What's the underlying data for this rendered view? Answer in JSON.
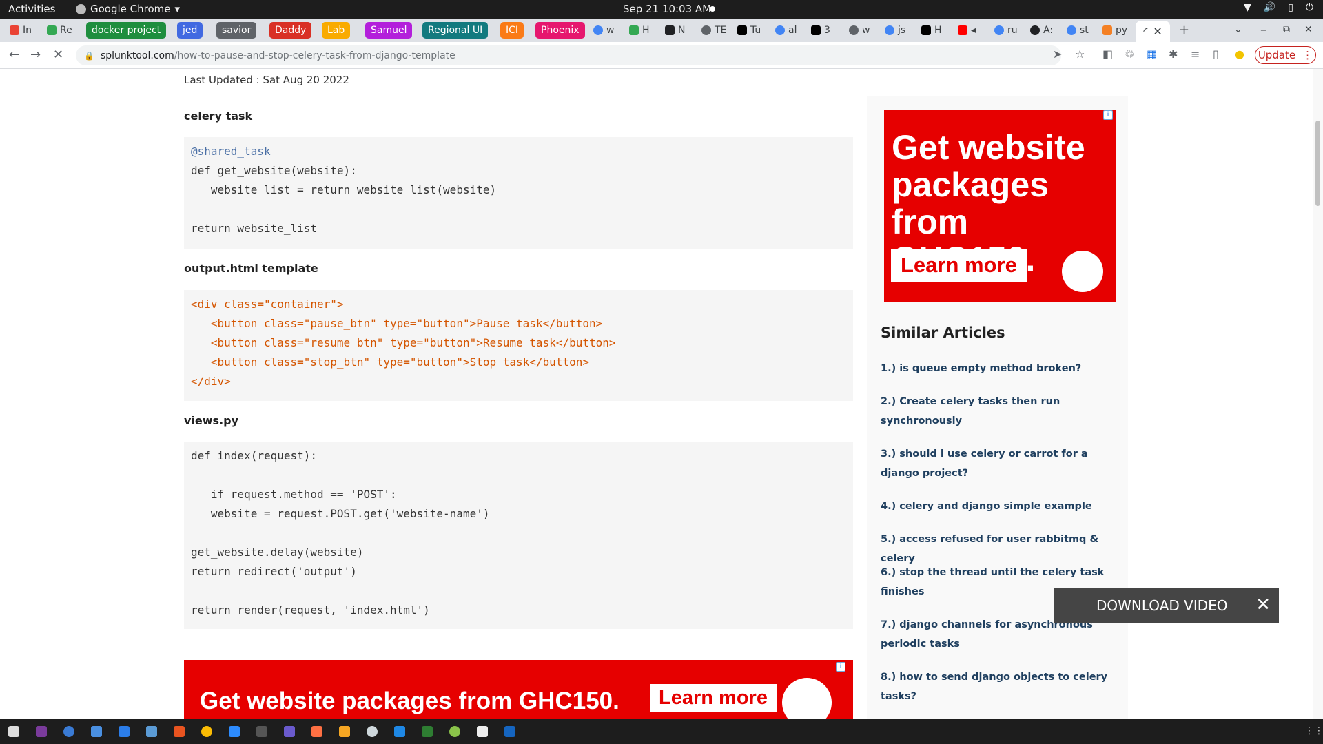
{
  "topbar": {
    "activities": "Activities",
    "app_name": "Google Chrome",
    "clock": "Sep 21  10:03 AM",
    "tray": [
      "▼",
      "🔊",
      "▯",
      "⏻"
    ]
  },
  "tabs": {
    "items": [
      {
        "label": "In",
        "color": "#ea4335"
      },
      {
        "label": "Re",
        "color": "#34a853"
      }
    ],
    "groups": [
      {
        "label": "docker project",
        "color": "#1e8e3e"
      },
      {
        "label": "jed",
        "color": "#4169e1"
      },
      {
        "label": "savior",
        "color": "#5f6368"
      },
      {
        "label": "Daddy",
        "color": "#d93025"
      },
      {
        "label": "Lab",
        "color": "#f9ab00"
      },
      {
        "label": "Samuel",
        "color": "#b31fdb"
      },
      {
        "label": "Regional UI",
        "color": "#137a7f"
      },
      {
        "label": "ICI",
        "color": "#fa7b17"
      },
      {
        "label": "Phoenix",
        "color": "#e6176e"
      }
    ],
    "mini": [
      "w",
      "H",
      "N",
      "TE",
      "Tu",
      "al",
      "3",
      "w",
      "js",
      "H",
      "ru",
      "A:",
      "st",
      "py"
    ],
    "new_tab": "+",
    "window_controls": [
      "⌄",
      "–",
      "⧉",
      "✕"
    ]
  },
  "nav": {
    "url_host": "splunktool.com",
    "url_path": "/how-to-pause-and-stop-celery-task-from-django-template",
    "update_label": "Update"
  },
  "article": {
    "last_updated": "Last Updated : Sat Aug 20 2022",
    "sections": [
      {
        "heading": "celery task"
      },
      {
        "heading": "output.html template"
      },
      {
        "heading": "views.py"
      }
    ],
    "code1": [
      "@shared_task",
      "def get_website(website):",
      "   website_list = return_website_list(website)",
      "",
      "return website_list"
    ],
    "code2": [
      "<div class=\"container\">",
      "   <button class=\"pause_btn\" type=\"button\">Pause task</button>",
      "   <button class=\"resume_btn\" type=\"button\">Resume task</button>",
      "   <button class=\"stop_btn\" type=\"button\">Stop task</button>",
      "</div>"
    ],
    "code3": [
      "def index(request):",
      "",
      "   if request.method == 'POST':",
      "   website = request.POST.get('website-name')",
      "",
      "get_website.delay(website)",
      "return redirect('output')",
      "",
      "return render(request, 'index.html')"
    ]
  },
  "ads": {
    "side_text": "Get website packages from GHC150.",
    "side_cta": "Learn more",
    "bottom_text": "Get website packages from GHC150.",
    "bottom_cta": "Learn more",
    "brand_color": "#e60000"
  },
  "similar": {
    "title": "Similar Articles",
    "items": [
      "1.) is queue empty method broken?",
      "2.) Create celery tasks then run synchronously",
      "3.) should i use celery or carrot for a django project?",
      "4.) celery and django simple example",
      "5.) access refused for user rabbitmq & celery",
      "6.) stop the thread until the celery task finishes",
      "7.) django channels for asynchronous periodic tasks",
      "8.) how to send django objects to celery tasks?"
    ]
  },
  "overlay": {
    "download_label": "DOWNLOAD VIDEO",
    "close_glyph": "✕"
  }
}
